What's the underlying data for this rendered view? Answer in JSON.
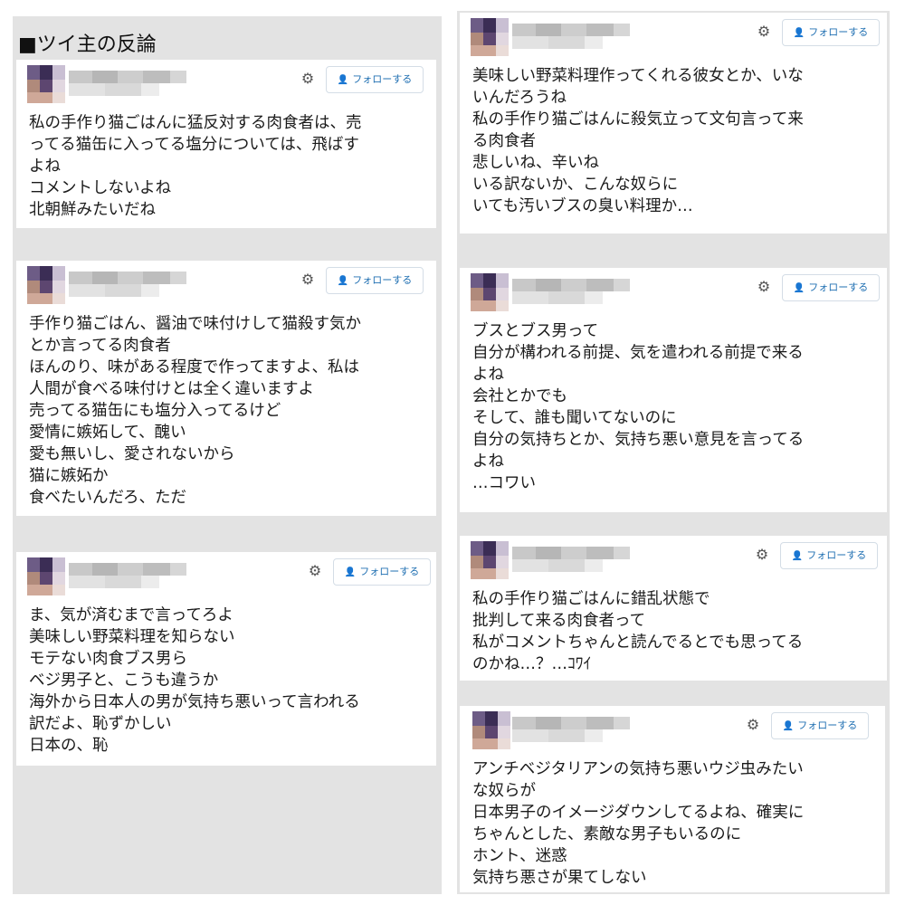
{
  "heading": "■ツイ主の反論",
  "follow_label": "フォローする",
  "icons": {
    "gear": "gear-icon",
    "follow": "user-plus-icon"
  },
  "posts": [
    {
      "text": "私の手作り猫ごはんに猛反対する肉食者は、売\nってる猫缶に入ってる塩分については、飛ばす\nよね\nコメントしないよね\n北朝鮮みたいだね"
    },
    {
      "text": "手作り猫ごはん、醤油で味付けして猫殺す気か\nとか言ってる肉食者\nほんのり、味がある程度で作ってますよ、私は\n人間が食べる味付けとは全く違いますよ\n売ってる猫缶にも塩分入ってるけど\n愛情に嫉妬して、醜い\n愛も無いし、愛されないから\n猫に嫉妬か\n食べたいんだろ、ただ"
    },
    {
      "text": "ま、気が済むまで言ってろよ\n美味しい野菜料理を知らない\nモテない肉食ブス男ら\nベジ男子と、こうも違うか\n海外から日本人の男が気持ち悪いって言われる\n訳だよ、恥ずかしい\n日本の、恥"
    },
    {
      "text": "美味しい野菜料理作ってくれる彼女とか、いな\nいんだろうね\n私の手作り猫ごはんに殺気立って文句言って来\nる肉食者\n悲しいね、辛いね\nいる訳ないか、こんな奴らに\nいても汚いブスの臭い料理か…"
    },
    {
      "text": "ブスとブス男って\n自分が構われる前提、気を遣われる前提で来る\nよね\n会社とかでも\nそして、誰も聞いてないのに\n自分の気持ちとか、気持ち悪い意見を言ってる\nよね\n…コワい"
    },
    {
      "text": "私の手作り猫ごはんに錯乱状態で\n批判して来る肉食者って\n私がコメントちゃんと読んでるとでも思ってる\nのかね…？…ｺﾜｲ"
    },
    {
      "text": "アンチベジタリアンの気持ち悪いウジ虫みたい\nな奴らが\n日本男子のイメージダウンしてるよね、確実に\nちゃんとした、素敵な男子もいるのに\nホント、迷惑\n気持ち悪さが果てしない"
    }
  ]
}
